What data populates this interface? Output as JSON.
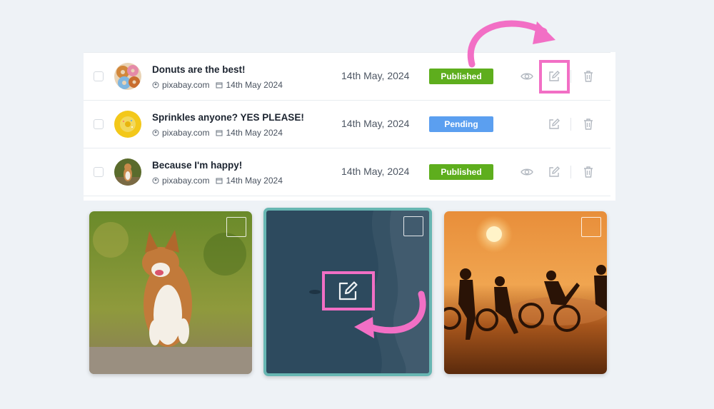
{
  "posts": [
    {
      "title": "Donuts are the best!",
      "source": "pixabay.com",
      "date_meta": "14th May 2024",
      "date": "14th May, 2024",
      "status": "Published",
      "status_color": "#5eae1d",
      "avatar": "donuts",
      "actions": [
        "eye-icon",
        "edit-icon",
        "trash-icon"
      ]
    },
    {
      "title": "Sprinkles anyone? YES PLEASE!",
      "source": "pixabay.com",
      "date_meta": "14th May 2024",
      "date": "14th May, 2024",
      "status": "Pending",
      "status_color": "#5b9ff0",
      "avatar": "yellow-donut",
      "actions": [
        "edit-icon",
        "trash-icon"
      ]
    },
    {
      "title": "Because I'm happy!",
      "source": "pixabay.com",
      "date_meta": "14th May 2024",
      "date": "14th May, 2024",
      "status": "Published",
      "status_color": "#5eae1d",
      "avatar": "dog",
      "actions": [
        "eye-icon",
        "edit-icon",
        "trash-icon"
      ]
    }
  ],
  "gallery": [
    {
      "image": "dog-photo",
      "selected": false
    },
    {
      "image": "ocean-photo",
      "selected": true,
      "overlay_icon": "edit-icon"
    },
    {
      "image": "sunset-bikes-photo",
      "selected": false
    }
  ],
  "colors": {
    "highlight": "#f26fc5",
    "active_border": "#67b6b2",
    "published": "#5eae1d",
    "pending": "#5b9ff0"
  }
}
